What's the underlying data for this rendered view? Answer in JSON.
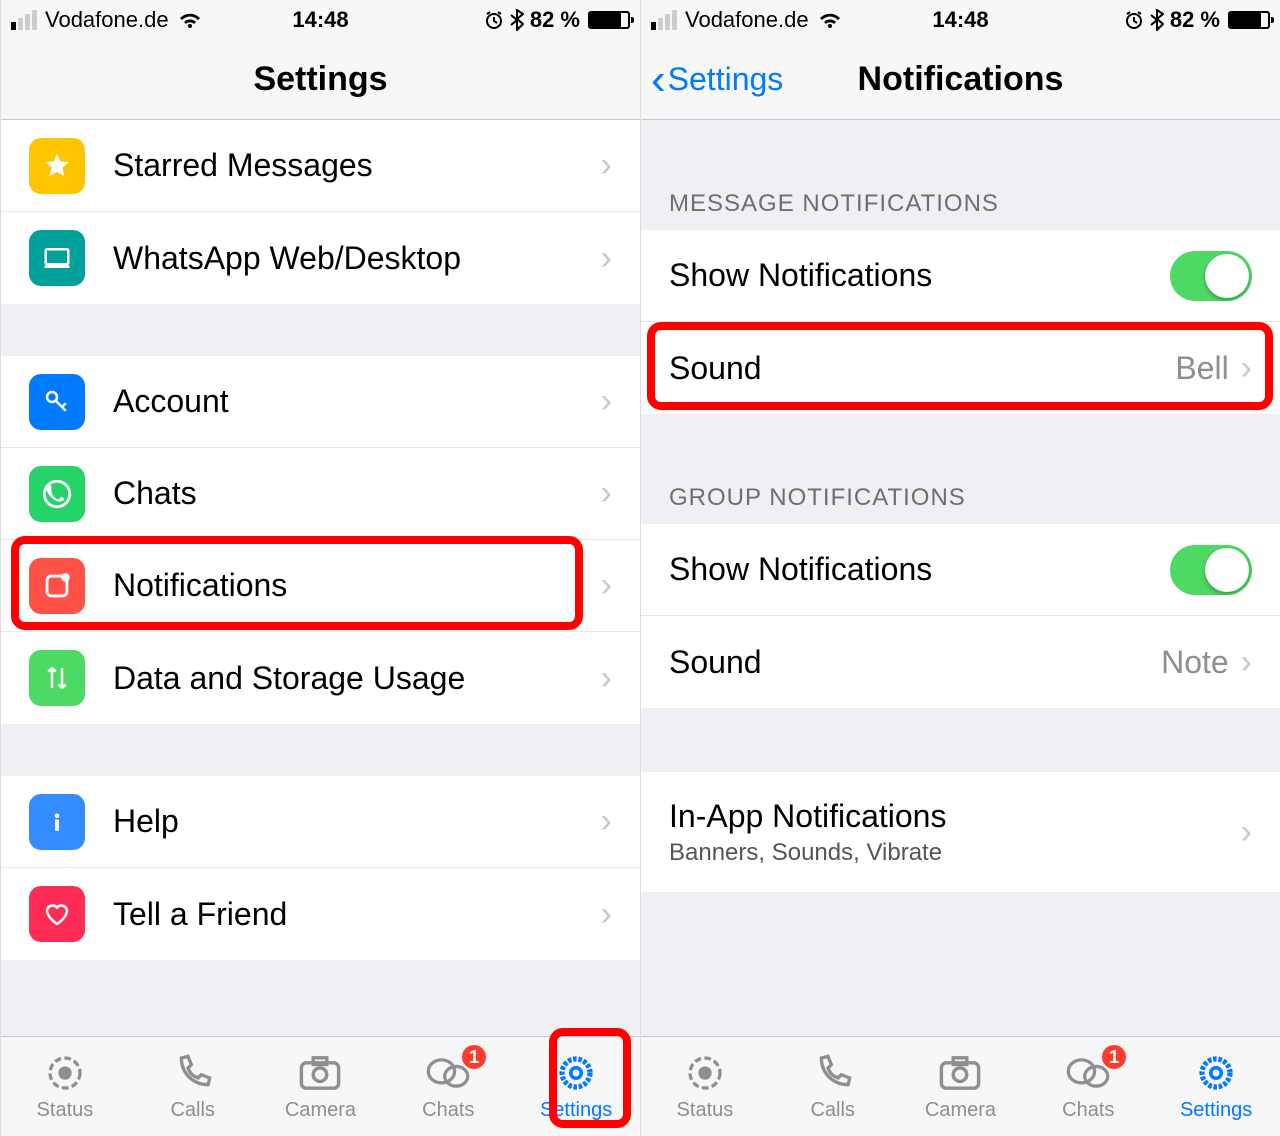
{
  "status": {
    "carrier": "Vodafone.de",
    "time": "14:48",
    "battery_pct": "82 %"
  },
  "left": {
    "nav_title": "Settings",
    "groups": [
      {
        "rows": [
          {
            "icon": "star",
            "icon_bg": "bg-yellow",
            "label": "Starred Messages"
          },
          {
            "icon": "desktop",
            "icon_bg": "bg-teal",
            "label": "WhatsApp Web/Desktop"
          }
        ]
      },
      {
        "rows": [
          {
            "icon": "key",
            "icon_bg": "bg-blue",
            "label": "Account"
          },
          {
            "icon": "whatsapp",
            "icon_bg": "bg-green",
            "label": "Chats"
          },
          {
            "icon": "notification",
            "icon_bg": "bg-red",
            "label": "Notifications",
            "highlighted": true
          },
          {
            "icon": "arrows",
            "icon_bg": "bg-green2",
            "label": "Data and Storage Usage"
          }
        ]
      },
      {
        "rows": [
          {
            "icon": "info",
            "icon_bg": "bg-blue2",
            "label": "Help"
          },
          {
            "icon": "heart",
            "icon_bg": "bg-pink",
            "label": "Tell a Friend"
          }
        ]
      }
    ]
  },
  "right": {
    "back_label": "Settings",
    "nav_title": "Notifications",
    "section1_header": "MESSAGE NOTIFICATIONS",
    "section1": {
      "show_label": "Show Notifications",
      "sound_label": "Sound",
      "sound_value": "Bell"
    },
    "section2_header": "GROUP NOTIFICATIONS",
    "section2": {
      "show_label": "Show Notifications",
      "sound_label": "Sound",
      "sound_value": "Note"
    },
    "section3": {
      "inapp_label": "In-App Notifications",
      "inapp_sub": "Banners, Sounds, Vibrate"
    }
  },
  "tabs": {
    "items": [
      {
        "label": "Status",
        "icon": "status"
      },
      {
        "label": "Calls",
        "icon": "phone"
      },
      {
        "label": "Camera",
        "icon": "camera"
      },
      {
        "label": "Chats",
        "icon": "chat",
        "badge": "1"
      },
      {
        "label": "Settings",
        "icon": "gear",
        "active": true
      }
    ]
  }
}
